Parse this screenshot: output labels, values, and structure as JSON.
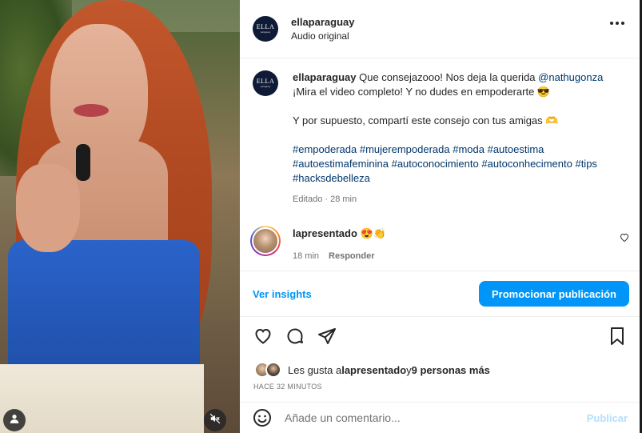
{
  "post": {
    "author": "ellaparaguay",
    "audio": "Audio original",
    "avatar_logo": "ELLA",
    "avatar_logo_sub": "paraguay"
  },
  "caption": {
    "username": "ellaparaguay",
    "text_before_mention": " Que consejazooo! Nos deja la querida ",
    "mention": "@nathugonza",
    "text_after_mention": " ¡Mira el video completo! Y no dudes en empoderarte 😎",
    "paragraph2": "Y por supuesto, compartí este consejo con tus amigas 🫶",
    "hashtags": [
      "#empoderada",
      "#mujerempoderada",
      "#moda",
      "#autoestima",
      "#autoestimafeminina",
      "#autoconocimiento",
      "#autoconhecimento",
      "#tips",
      "#hacksdebelleza"
    ],
    "meta": "Editado · 28 min"
  },
  "comment": {
    "username": "lapresentado",
    "text": "😍👏",
    "time": "18 min",
    "reply_label": "Responder"
  },
  "insights_bar": {
    "insights_label": "Ver insights",
    "promote_label": "Promocionar publicación"
  },
  "likes": {
    "prefix": "Les gusta a ",
    "user": "lapresentado",
    "middle": " y ",
    "others": "9 personas más"
  },
  "time_ago": "HACE 32 MINUTOS",
  "add_comment": {
    "placeholder": "Añade un comentario...",
    "publish_label": "Publicar"
  },
  "icons": {
    "header_more": "more-horizontal-icon",
    "like": "heart-icon",
    "comment": "comment-bubble-icon",
    "share": "paper-plane-icon",
    "save": "bookmark-icon",
    "emoji": "smiley-icon",
    "video_user": "user-tag-icon",
    "video_mute": "speaker-muted-icon"
  },
  "colors": {
    "accent": "#0095f6",
    "link": "#00376b",
    "muted_text": "#737373",
    "publish_disabled": "#b2dffc"
  }
}
